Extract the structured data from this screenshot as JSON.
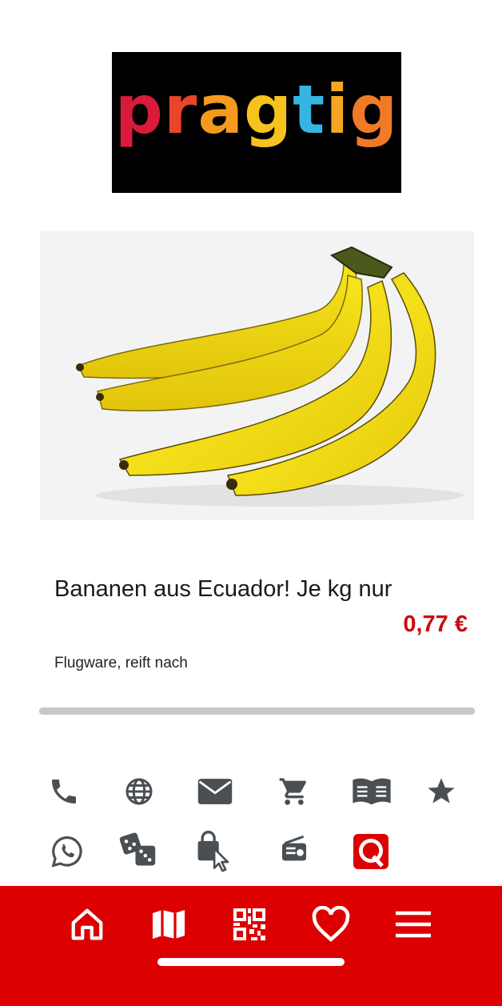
{
  "logo": {
    "text": "pragtig",
    "letters": [
      {
        "ch": "p",
        "color": "#d81b3a"
      },
      {
        "ch": "r",
        "color": "#e8452a"
      },
      {
        "ch": "a",
        "color": "#f49a1c"
      },
      {
        "ch": "g",
        "color": "#f6c21e"
      },
      {
        "ch": "t",
        "color": "#35b6e0"
      },
      {
        "ch": "i",
        "color": "#f5a623"
      },
      {
        "ch": "g",
        "color": "#f07a26"
      }
    ]
  },
  "product": {
    "image": "bananas-image",
    "title": "Bananen aus Ecuador! Je kg nur",
    "price": "0,77 €",
    "description": "Flugware, reift nach"
  },
  "action_icons": [
    {
      "name": "phone-icon"
    },
    {
      "name": "globe-icon"
    },
    {
      "name": "mail-icon"
    },
    {
      "name": "cart-icon"
    },
    {
      "name": "book-icon"
    },
    {
      "name": "star-icon"
    },
    {
      "name": "whatsapp-icon"
    },
    {
      "name": "dice-icon"
    },
    {
      "name": "shopping-bag-cursor-icon"
    },
    {
      "name": "radio-icon"
    },
    {
      "name": "q-app-icon"
    }
  ],
  "bottom_nav": [
    {
      "name": "home-icon"
    },
    {
      "name": "map-icon"
    },
    {
      "name": "qr-code-icon"
    },
    {
      "name": "heart-icon"
    },
    {
      "name": "menu-icon"
    }
  ],
  "colors": {
    "accent_red": "#dd0000",
    "price_red": "#cc0a0a",
    "icon_gray": "#4a4f54"
  }
}
